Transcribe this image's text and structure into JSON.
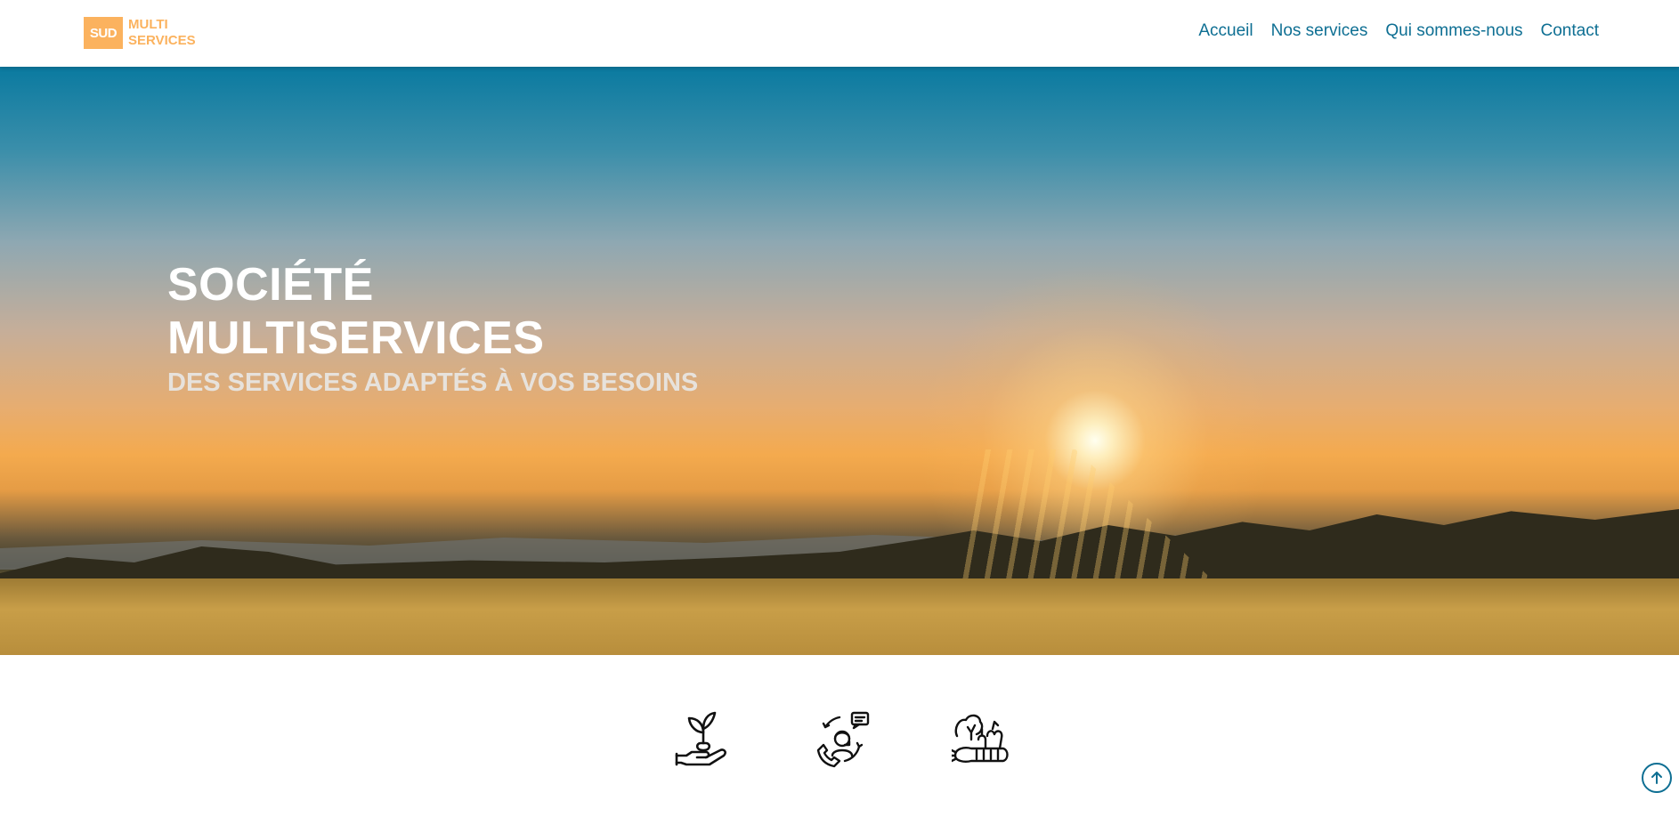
{
  "logo": {
    "badge": "SUD",
    "line1": "MULTI",
    "line2": "SERVICES"
  },
  "nav": {
    "items": [
      "Accueil",
      "Nos services",
      "Qui sommes-nous",
      "Contact"
    ]
  },
  "hero": {
    "title_line1": "SOCIÉTÉ",
    "title_line2": "MULTISERVICES",
    "subtitle": "DES SERVICES ADAPTÉS À VOS BESOINS"
  },
  "services_icons": [
    "plant-in-hand-icon",
    "customer-support-icon",
    "vegetables-icon"
  ],
  "colors": {
    "brand_orange": "#fbb25e",
    "link_blue": "#0e6f93"
  }
}
